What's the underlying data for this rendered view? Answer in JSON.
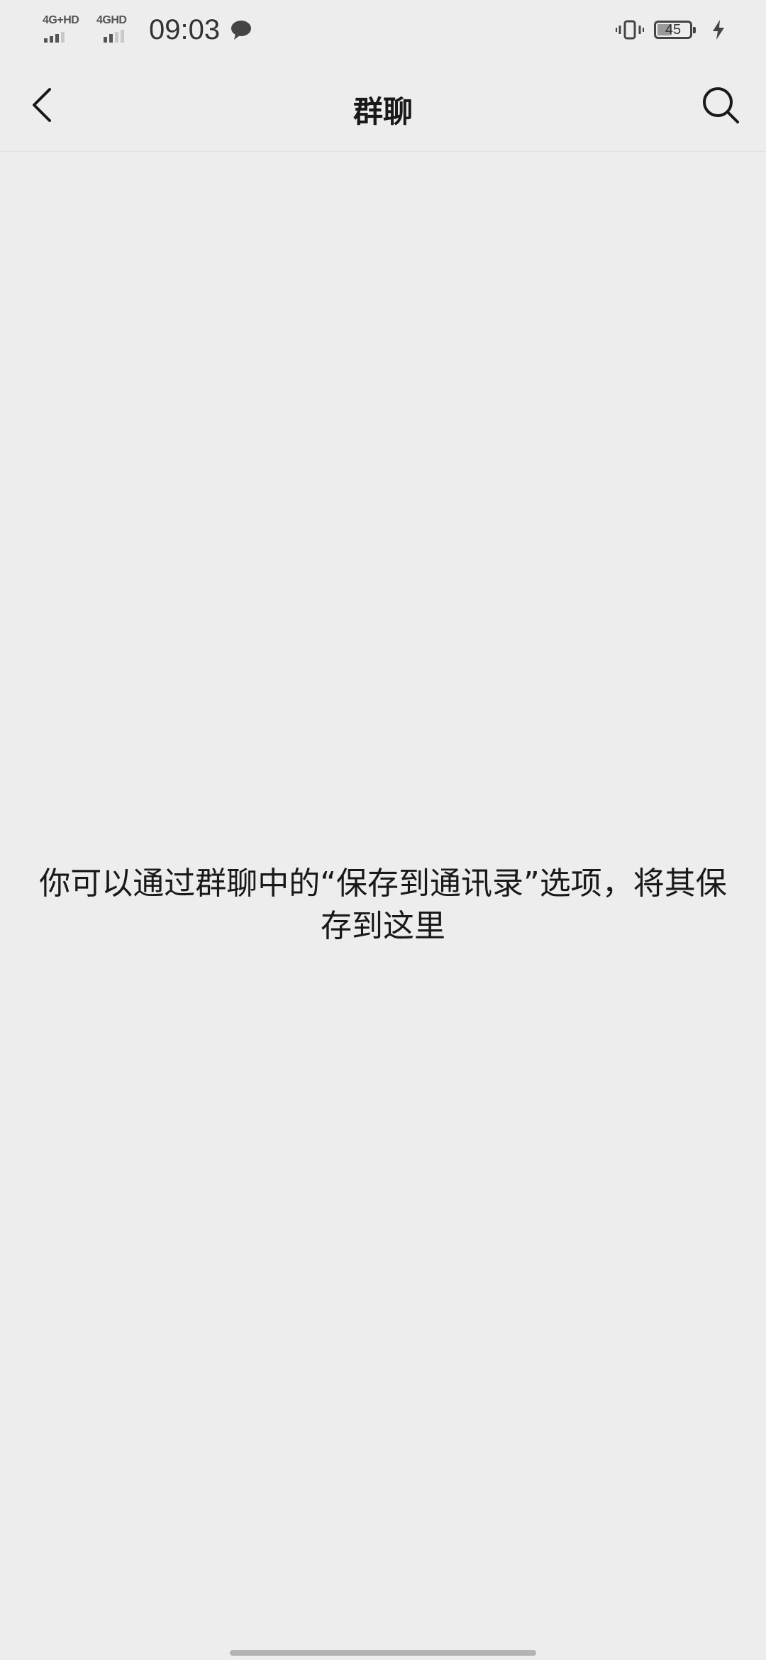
{
  "status_bar": {
    "sim1_label": "4G+HD",
    "sim2_label": "4GHD",
    "time": "09:03",
    "battery_level": "45",
    "battery_fraction": 0.45,
    "icons": [
      "signal-sim1-icon",
      "signal-sim2-icon",
      "chat-notification-icon",
      "vibrate-icon",
      "battery-icon",
      "charging-icon"
    ]
  },
  "nav": {
    "title": "群聊",
    "back_icon": "back-chevron-icon",
    "search_icon": "search-icon"
  },
  "empty_state": {
    "message": "你可以通过群聊中的“保存到通讯录”选项，将其保存到这里"
  }
}
